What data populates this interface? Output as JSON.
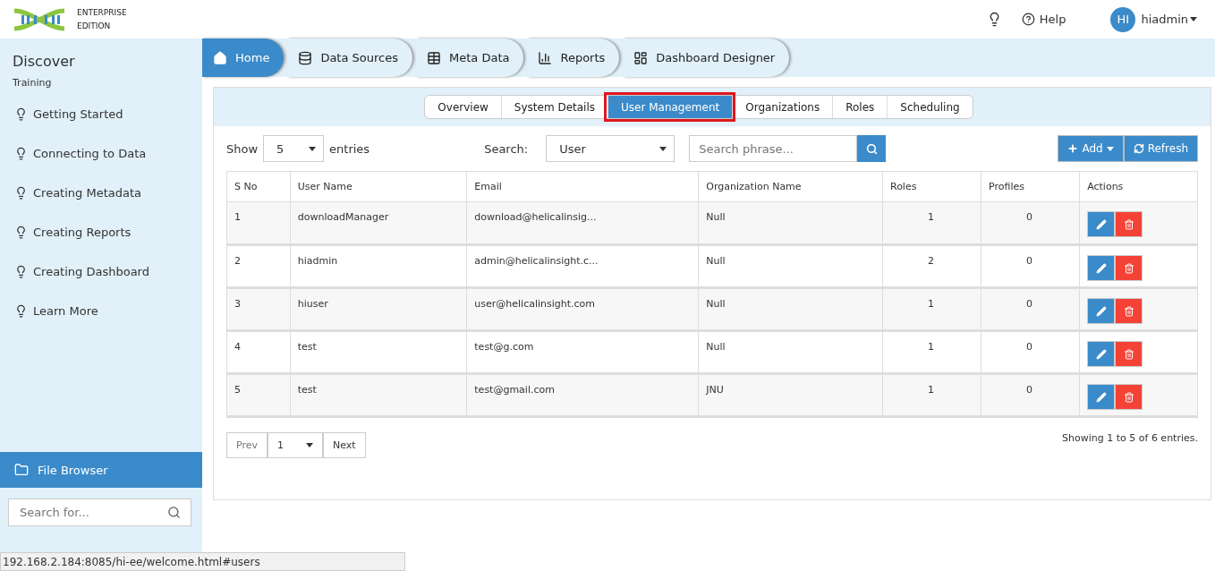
{
  "brand": {
    "line1": "ENTERPRISE",
    "line2": "EDITION"
  },
  "header": {
    "help": "Help",
    "avatar": "HI",
    "user": "hiadmin"
  },
  "sidebar": {
    "title": "Discover",
    "subtitle": "Training",
    "items": [
      "Getting Started",
      "Connecting to Data",
      "Creating Metadata",
      "Creating Reports",
      "Creating Dashboard",
      "Learn More"
    ],
    "file_browser": "File Browser",
    "search": {
      "placeholder": "Search for..."
    }
  },
  "nav_tabs": [
    {
      "label": "Home",
      "selected": true
    },
    {
      "label": "Data Sources",
      "selected": false
    },
    {
      "label": "Meta Data",
      "selected": false
    },
    {
      "label": "Reports",
      "selected": false
    },
    {
      "label": "Dashboard Designer",
      "selected": false
    }
  ],
  "sub_tabs": [
    {
      "label": "Overview",
      "selected": false
    },
    {
      "label": "System Details",
      "selected": false
    },
    {
      "label": "User Management",
      "selected": true
    },
    {
      "label": "Organizations",
      "selected": false
    },
    {
      "label": "Roles",
      "selected": false
    },
    {
      "label": "Scheduling",
      "selected": false
    }
  ],
  "toolbar": {
    "show_label": "Show",
    "page_size": "5",
    "entries_label": "entries",
    "search_label": "Search:",
    "search_by": "User",
    "search": {
      "placeholder": "Search phrase..."
    },
    "add": "Add",
    "refresh": "Refresh"
  },
  "table": {
    "columns": [
      "S No",
      "User Name",
      "Email",
      "Organization Name",
      "Roles",
      "Profiles",
      "Actions"
    ],
    "rows": [
      [
        "1",
        "downloadManager",
        "download@helicalinsig...",
        "Null",
        "1",
        "0"
      ],
      [
        "2",
        "hiadmin",
        "admin@helicalinsight.c...",
        "Null",
        "2",
        "0"
      ],
      [
        "3",
        "hiuser",
        "user@helicalinsight.com",
        "Null",
        "1",
        "0"
      ],
      [
        "4",
        "test",
        "test@g.com",
        "Null",
        "1",
        "0"
      ],
      [
        "5",
        "test",
        "test@gmail.com",
        "JNU",
        "1",
        "0"
      ]
    ]
  },
  "pagination": {
    "prev": "Prev",
    "page": "1",
    "next": "Next",
    "summary": "Showing 1 to 5 of 6 entries."
  },
  "status_url": "192.168.2.184:8085/hi-ee/welcome.html#users"
}
